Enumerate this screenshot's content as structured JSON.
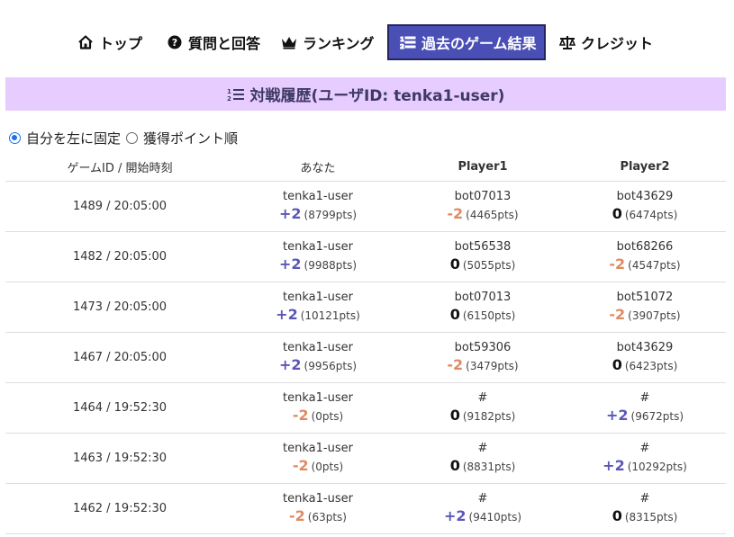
{
  "nav": {
    "items": [
      {
        "label": "トップ",
        "icon": "home-icon"
      },
      {
        "label": "質問と回答",
        "icon": "question-circle-icon"
      },
      {
        "label": "ランキング",
        "icon": "crown-icon"
      },
      {
        "label": "過去のゲーム結果",
        "icon": "ordered-list-icon",
        "active": true
      },
      {
        "label": "クレジット",
        "icon": "scale-icon"
      }
    ]
  },
  "title": "対戦履歴(ユーザID: tenka1-user)",
  "sort_options": [
    {
      "label": "自分を左に固定",
      "selected": true
    },
    {
      "label": "獲得ポイント順",
      "selected": false
    }
  ],
  "columns": [
    "ゲームID / 開始時刻",
    "あなた",
    "Player1",
    "Player2"
  ],
  "colors": {
    "positive": "#5b57b8",
    "negative": "#e08a63",
    "zero": "#111111",
    "title_bg": "#e6ccff",
    "active_nav": "#4a4fb6"
  },
  "rows": [
    {
      "game": "1489 / 20:05:00",
      "players": [
        {
          "name": "tenka1-user",
          "score": "+2",
          "pts": "(8799pts)"
        },
        {
          "name": "bot07013",
          "score": "-2",
          "pts": "(4465pts)"
        },
        {
          "name": "bot43629",
          "score": "0",
          "pts": "(6474pts)"
        }
      ]
    },
    {
      "game": "1482 / 20:05:00",
      "players": [
        {
          "name": "tenka1-user",
          "score": "+2",
          "pts": "(9988pts)"
        },
        {
          "name": "bot56538",
          "score": "0",
          "pts": "(5055pts)"
        },
        {
          "name": "bot68266",
          "score": "-2",
          "pts": "(4547pts)"
        }
      ]
    },
    {
      "game": "1473 / 20:05:00",
      "players": [
        {
          "name": "tenka1-user",
          "score": "+2",
          "pts": "(10121pts)"
        },
        {
          "name": "bot07013",
          "score": "0",
          "pts": "(6150pts)"
        },
        {
          "name": "bot51072",
          "score": "-2",
          "pts": "(3907pts)"
        }
      ]
    },
    {
      "game": "1467 / 20:05:00",
      "players": [
        {
          "name": "tenka1-user",
          "score": "+2",
          "pts": "(9956pts)"
        },
        {
          "name": "bot59306",
          "score": "-2",
          "pts": "(3479pts)"
        },
        {
          "name": "bot43629",
          "score": "0",
          "pts": "(6423pts)"
        }
      ]
    },
    {
      "game": "1464 / 19:52:30",
      "players": [
        {
          "name": "tenka1-user",
          "score": "-2",
          "pts": "(0pts)"
        },
        {
          "name": "#",
          "score": "0",
          "pts": "(9182pts)"
        },
        {
          "name": "#",
          "score": "+2",
          "pts": "(9672pts)"
        }
      ]
    },
    {
      "game": "1463 / 19:52:30",
      "players": [
        {
          "name": "tenka1-user",
          "score": "-2",
          "pts": "(0pts)"
        },
        {
          "name": "#",
          "score": "0",
          "pts": "(8831pts)"
        },
        {
          "name": "#",
          "score": "+2",
          "pts": "(10292pts)"
        }
      ]
    },
    {
      "game": "1462 / 19:52:30",
      "players": [
        {
          "name": "tenka1-user",
          "score": "-2",
          "pts": "(63pts)"
        },
        {
          "name": "#",
          "score": "+2",
          "pts": "(9410pts)"
        },
        {
          "name": "#",
          "score": "0",
          "pts": "(8315pts)"
        }
      ]
    }
  ]
}
